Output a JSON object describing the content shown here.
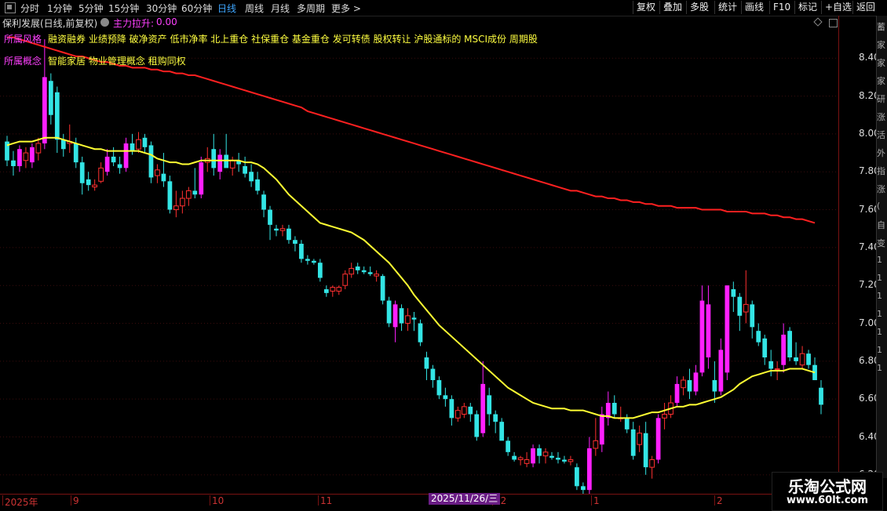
{
  "toolbar": {
    "periods": [
      {
        "label": "分时",
        "active": false
      },
      {
        "label": "1分钟",
        "active": false
      },
      {
        "label": "5分钟",
        "active": false
      },
      {
        "label": "15分钟",
        "active": false
      },
      {
        "label": "30分钟",
        "active": false
      },
      {
        "label": "60分钟",
        "active": false
      },
      {
        "label": "日线",
        "active": true
      },
      {
        "label": "周线",
        "active": false
      },
      {
        "label": "月线",
        "active": false
      },
      {
        "label": "多周期",
        "active": false
      },
      {
        "label": "更多 >",
        "active": false
      }
    ],
    "tools": [
      "复权",
      "叠加",
      "多股",
      "统计",
      "画线",
      "F10",
      "标记",
      "+自选",
      "返回"
    ]
  },
  "info": {
    "stock_title": "保利发展(日线,前复权)",
    "indicator_label": "主力拉升:",
    "indicator_value": "0.00"
  },
  "tags": {
    "risk_label": "所属风格",
    "risk_value": "融资融券 业绩预降 破净资产 低市净率 北上重仓 社保重仓 基金重仓 发可转债 股权转让 沪股通标的 MSCI成份 周期股",
    "concept_label": "所属概念",
    "concept_value": "智能家居 物业管理概念 租购同权"
  },
  "axis": {
    "y_ticks": [
      "8.40",
      "8.20",
      "8.00",
      "7.80",
      "7.60",
      "7.40",
      "7.20",
      "7.00",
      "6.80",
      "6.60",
      "6.40",
      "6.20"
    ],
    "date_labels": [
      "2025年",
      "9",
      "10",
      "11",
      "12",
      "1",
      "2"
    ],
    "hover_date": "2025/11/26/三"
  },
  "watermark": {
    "title": "乐淘公式网",
    "url": "www.60lt.com"
  },
  "side_text": [
    "蓄",
    "家",
    "家",
    "家",
    "研",
    "涨",
    "活",
    "外",
    "指",
    "涨",
    "(",
    "自",
    "变",
    "1",
    "1",
    "1",
    "1",
    "1",
    "1",
    "1"
  ],
  "colors": {
    "up": "#ff3030",
    "down": "#33e5e5",
    "magenta": "#ff20ff",
    "ma_short": "#ffff33",
    "ma_long": "#ff2020"
  },
  "chart_data": {
    "type": "candlestick",
    "ylim": [
      6.1,
      8.55
    ],
    "series": [
      {
        "name": "candles",
        "ohlc": [
          [
            7.96,
            7.99,
            7.83,
            7.86
          ],
          [
            7.86,
            7.91,
            7.78,
            7.83
          ],
          [
            7.83,
            7.94,
            7.8,
            7.92
          ],
          [
            7.86,
            7.93,
            7.82,
            7.9
          ],
          [
            7.85,
            7.95,
            7.82,
            7.93
          ],
          [
            7.9,
            7.98,
            7.86,
            7.95
          ],
          [
            7.95,
            8.5,
            7.92,
            8.3
          ],
          [
            8.28,
            8.32,
            8.05,
            8.1
          ],
          [
            8.22,
            8.25,
            7.9,
            7.97
          ],
          [
            7.97,
            8.0,
            7.88,
            7.92
          ],
          [
            7.95,
            8.05,
            7.9,
            7.96
          ],
          [
            7.95,
            7.98,
            7.82,
            7.85
          ],
          [
            7.85,
            7.88,
            7.68,
            7.74
          ],
          [
            7.76,
            7.8,
            7.7,
            7.73
          ],
          [
            7.72,
            7.76,
            7.7,
            7.73
          ],
          [
            7.75,
            7.85,
            7.74,
            7.82
          ],
          [
            7.8,
            7.92,
            7.78,
            7.88
          ],
          [
            7.88,
            7.93,
            7.83,
            7.85
          ],
          [
            7.84,
            7.88,
            7.79,
            7.82
          ],
          [
            7.82,
            7.98,
            7.8,
            7.95
          ],
          [
            7.95,
            8.0,
            7.89,
            7.91
          ],
          [
            7.92,
            8.01,
            7.9,
            7.97
          ],
          [
            7.98,
            8.0,
            7.9,
            7.93
          ],
          [
            7.94,
            7.96,
            7.74,
            7.77
          ],
          [
            7.78,
            7.84,
            7.74,
            7.81
          ],
          [
            7.79,
            7.9,
            7.72,
            7.75
          ],
          [
            7.75,
            7.78,
            7.58,
            7.6
          ],
          [
            7.6,
            7.7,
            7.56,
            7.62
          ],
          [
            7.62,
            7.7,
            7.58,
            7.66
          ],
          [
            7.66,
            7.72,
            7.62,
            7.7
          ],
          [
            7.7,
            7.82,
            7.66,
            7.68
          ],
          [
            7.68,
            7.88,
            7.66,
            7.85
          ],
          [
            7.85,
            7.93,
            7.8,
            7.87
          ],
          [
            7.92,
            8.0,
            7.78,
            7.82
          ],
          [
            7.8,
            7.92,
            7.76,
            7.89
          ],
          [
            7.89,
            8.0,
            7.86,
            7.82
          ],
          [
            7.82,
            7.88,
            7.78,
            7.86
          ],
          [
            7.86,
            7.9,
            7.8,
            7.84
          ],
          [
            7.83,
            7.88,
            7.77,
            7.79
          ],
          [
            7.8,
            7.84,
            7.72,
            7.75
          ],
          [
            7.76,
            7.8,
            7.68,
            7.7
          ],
          [
            7.68,
            7.7,
            7.56,
            7.6
          ],
          [
            7.6,
            7.62,
            7.44,
            7.52
          ],
          [
            7.5,
            7.52,
            7.46,
            7.49
          ],
          [
            7.49,
            7.52,
            7.46,
            7.5
          ],
          [
            7.5,
            7.52,
            7.42,
            7.44
          ],
          [
            7.44,
            7.46,
            7.38,
            7.42
          ],
          [
            7.42,
            7.44,
            7.32,
            7.34
          ],
          [
            7.34,
            7.36,
            7.31,
            7.33
          ],
          [
            7.33,
            7.34,
            7.31,
            7.32
          ],
          [
            7.32,
            7.34,
            7.22,
            7.24
          ],
          [
            7.18,
            7.2,
            7.14,
            7.16
          ],
          [
            7.17,
            7.2,
            7.14,
            7.19
          ],
          [
            7.17,
            7.2,
            7.15,
            7.19
          ],
          [
            7.2,
            7.28,
            7.18,
            7.26
          ],
          [
            7.26,
            7.32,
            7.24,
            7.29
          ],
          [
            7.3,
            7.32,
            7.26,
            7.28
          ],
          [
            7.28,
            7.3,
            7.26,
            7.27
          ],
          [
            7.27,
            7.3,
            7.25,
            7.26
          ],
          [
            7.25,
            7.28,
            7.22,
            7.26
          ],
          [
            7.25,
            7.26,
            7.1,
            7.12
          ],
          [
            7.12,
            7.14,
            6.98,
            7.0
          ],
          [
            6.98,
            7.12,
            6.9,
            7.1
          ],
          [
            7.08,
            7.1,
            6.96,
            7.0
          ],
          [
            7.0,
            7.08,
            6.96,
            7.04
          ],
          [
            7.03,
            7.06,
            6.96,
            7.02
          ],
          [
            7.0,
            7.02,
            6.88,
            6.9
          ],
          [
            6.82,
            6.85,
            6.7,
            6.76
          ],
          [
            6.76,
            6.78,
            6.66,
            6.7
          ],
          [
            6.7,
            6.72,
            6.6,
            6.62
          ],
          [
            6.62,
            6.66,
            6.56,
            6.6
          ],
          [
            6.6,
            6.62,
            6.46,
            6.5
          ],
          [
            6.5,
            6.56,
            6.48,
            6.54
          ],
          [
            6.52,
            6.58,
            6.5,
            6.56
          ],
          [
            6.56,
            6.58,
            6.48,
            6.52
          ],
          [
            6.52,
            6.54,
            6.38,
            6.4
          ],
          [
            6.42,
            6.8,
            6.4,
            6.68
          ],
          [
            6.62,
            6.66,
            6.46,
            6.52
          ],
          [
            6.52,
            6.54,
            6.42,
            6.48
          ],
          [
            6.48,
            6.5,
            6.4,
            6.38
          ],
          [
            6.38,
            6.4,
            6.3,
            6.32
          ],
          [
            6.3,
            6.32,
            6.27,
            6.28
          ],
          [
            6.28,
            6.3,
            6.25,
            6.29
          ],
          [
            6.26,
            6.32,
            6.24,
            6.28
          ],
          [
            6.26,
            6.36,
            6.24,
            6.34
          ],
          [
            6.34,
            6.36,
            6.26,
            6.3
          ],
          [
            6.3,
            6.34,
            6.26,
            6.32
          ],
          [
            6.3,
            6.32,
            6.28,
            6.29
          ],
          [
            6.29,
            6.32,
            6.26,
            6.28
          ],
          [
            6.28,
            6.3,
            6.26,
            6.27
          ],
          [
            6.27,
            6.3,
            6.25,
            6.28
          ],
          [
            6.24,
            6.26,
            6.12,
            6.14
          ],
          [
            6.14,
            6.16,
            6.1,
            6.12
          ],
          [
            6.12,
            6.4,
            6.1,
            6.34
          ],
          [
            6.34,
            6.5,
            6.3,
            6.38
          ],
          [
            6.36,
            6.56,
            6.32,
            6.52
          ],
          [
            6.5,
            6.64,
            6.46,
            6.58
          ],
          [
            6.58,
            6.62,
            6.5,
            6.52
          ],
          [
            6.5,
            6.56,
            6.48,
            6.5
          ],
          [
            6.5,
            6.52,
            6.42,
            6.44
          ],
          [
            6.44,
            6.48,
            6.28,
            6.3
          ],
          [
            6.36,
            6.46,
            6.32,
            6.42
          ],
          [
            6.42,
            6.48,
            6.2,
            6.24
          ],
          [
            6.24,
            6.3,
            6.18,
            6.28
          ],
          [
            6.28,
            6.52,
            6.26,
            6.5
          ],
          [
            6.5,
            6.58,
            6.44,
            6.52
          ],
          [
            6.52,
            6.62,
            6.5,
            6.58
          ],
          [
            6.58,
            6.72,
            6.56,
            6.68
          ],
          [
            6.66,
            6.72,
            6.62,
            6.7
          ],
          [
            6.7,
            6.76,
            6.6,
            6.64
          ],
          [
            6.64,
            6.78,
            6.62,
            6.74
          ],
          [
            6.74,
            7.2,
            6.72,
            7.12
          ],
          [
            6.82,
            7.2,
            6.76,
            7.1
          ],
          [
            6.7,
            6.8,
            6.58,
            6.64
          ],
          [
            6.64,
            6.92,
            6.62,
            6.86
          ],
          [
            6.74,
            7.2,
            6.7,
            7.2
          ],
          [
            7.18,
            7.22,
            7.06,
            7.14
          ],
          [
            7.14,
            7.16,
            6.96,
            7.04
          ],
          [
            7.06,
            7.28,
            7.0,
            7.1
          ],
          [
            7.1,
            7.12,
            6.92,
            6.98
          ],
          [
            6.96,
            7.0,
            6.88,
            6.9
          ],
          [
            6.92,
            6.94,
            6.78,
            6.82
          ],
          [
            6.8,
            6.86,
            6.72,
            6.76
          ],
          [
            6.76,
            6.8,
            6.7,
            6.76
          ],
          [
            6.78,
            7.0,
            6.74,
            6.94
          ],
          [
            6.96,
            6.98,
            6.8,
            6.82
          ],
          [
            6.82,
            6.9,
            6.78,
            6.8
          ],
          [
            6.78,
            6.88,
            6.76,
            6.84
          ],
          [
            6.84,
            6.86,
            6.76,
            6.78
          ],
          [
            6.78,
            6.82,
            6.7,
            6.7
          ],
          [
            6.66,
            6.7,
            6.52,
            6.57
          ]
        ]
      },
      {
        "name": "ma_short",
        "y": [
          7.94,
          7.95,
          7.96,
          7.96,
          7.96,
          7.97,
          7.98,
          7.98,
          7.98,
          7.97,
          7.96,
          7.95,
          7.94,
          7.93,
          7.92,
          7.92,
          7.91,
          7.91,
          7.91,
          7.91,
          7.91,
          7.91,
          7.9,
          7.89,
          7.87,
          7.86,
          7.85,
          7.85,
          7.84,
          7.84,
          7.85,
          7.86,
          7.86,
          7.86,
          7.86,
          7.86,
          7.86,
          7.86,
          7.85,
          7.85,
          7.84,
          7.82,
          7.79,
          7.76,
          7.72,
          7.68,
          7.65,
          7.62,
          7.59,
          7.56,
          7.53,
          7.52,
          7.51,
          7.5,
          7.49,
          7.48,
          7.46,
          7.44,
          7.41,
          7.38,
          7.35,
          7.32,
          7.28,
          7.24,
          7.2,
          7.15,
          7.11,
          7.07,
          7.03,
          6.99,
          6.96,
          6.93,
          6.9,
          6.87,
          6.84,
          6.81,
          6.78,
          6.75,
          6.72,
          6.69,
          6.66,
          6.64,
          6.62,
          6.6,
          6.58,
          6.57,
          6.56,
          6.55,
          6.55,
          6.55,
          6.54,
          6.54,
          6.54,
          6.53,
          6.52,
          6.51,
          6.51,
          6.5,
          6.5,
          6.5,
          6.5,
          6.51,
          6.52,
          6.53,
          6.53,
          6.54,
          6.55,
          6.56,
          6.56,
          6.57,
          6.57,
          6.58,
          6.59,
          6.6,
          6.61,
          6.63,
          6.65,
          6.68,
          6.7,
          6.72,
          6.73,
          6.74,
          6.75,
          6.75,
          6.75,
          6.76,
          6.76,
          6.76,
          6.75,
          6.74
        ]
      },
      {
        "name": "ma_long",
        "y": [
          8.51,
          8.51,
          8.5,
          8.49,
          8.48,
          8.47,
          8.46,
          8.45,
          8.44,
          8.43,
          8.42,
          8.41,
          8.41,
          8.4,
          8.39,
          8.38,
          8.38,
          8.37,
          8.36,
          8.36,
          8.35,
          8.35,
          8.35,
          8.34,
          8.34,
          8.33,
          8.33,
          8.32,
          8.32,
          8.31,
          8.31,
          8.3,
          8.29,
          8.28,
          8.27,
          8.26,
          8.25,
          8.24,
          8.23,
          8.22,
          8.21,
          8.2,
          8.19,
          8.18,
          8.17,
          8.16,
          8.15,
          8.14,
          8.12,
          8.11,
          8.1,
          8.09,
          8.08,
          8.07,
          8.06,
          8.05,
          8.04,
          8.03,
          8.02,
          8.01,
          8.0,
          7.99,
          7.98,
          7.97,
          7.96,
          7.95,
          7.94,
          7.93,
          7.92,
          7.91,
          7.9,
          7.89,
          7.88,
          7.87,
          7.86,
          7.85,
          7.84,
          7.83,
          7.82,
          7.81,
          7.8,
          7.79,
          7.78,
          7.77,
          7.76,
          7.75,
          7.74,
          7.73,
          7.72,
          7.71,
          7.7,
          7.7,
          7.69,
          7.68,
          7.67,
          7.67,
          7.66,
          7.66,
          7.65,
          7.65,
          7.64,
          7.64,
          7.63,
          7.63,
          7.62,
          7.62,
          7.62,
          7.61,
          7.61,
          7.61,
          7.61,
          7.6,
          7.6,
          7.6,
          7.6,
          7.59,
          7.59,
          7.59,
          7.59,
          7.58,
          7.58,
          7.58,
          7.57,
          7.57,
          7.56,
          7.56,
          7.55,
          7.55,
          7.54,
          7.53
        ]
      }
    ]
  }
}
